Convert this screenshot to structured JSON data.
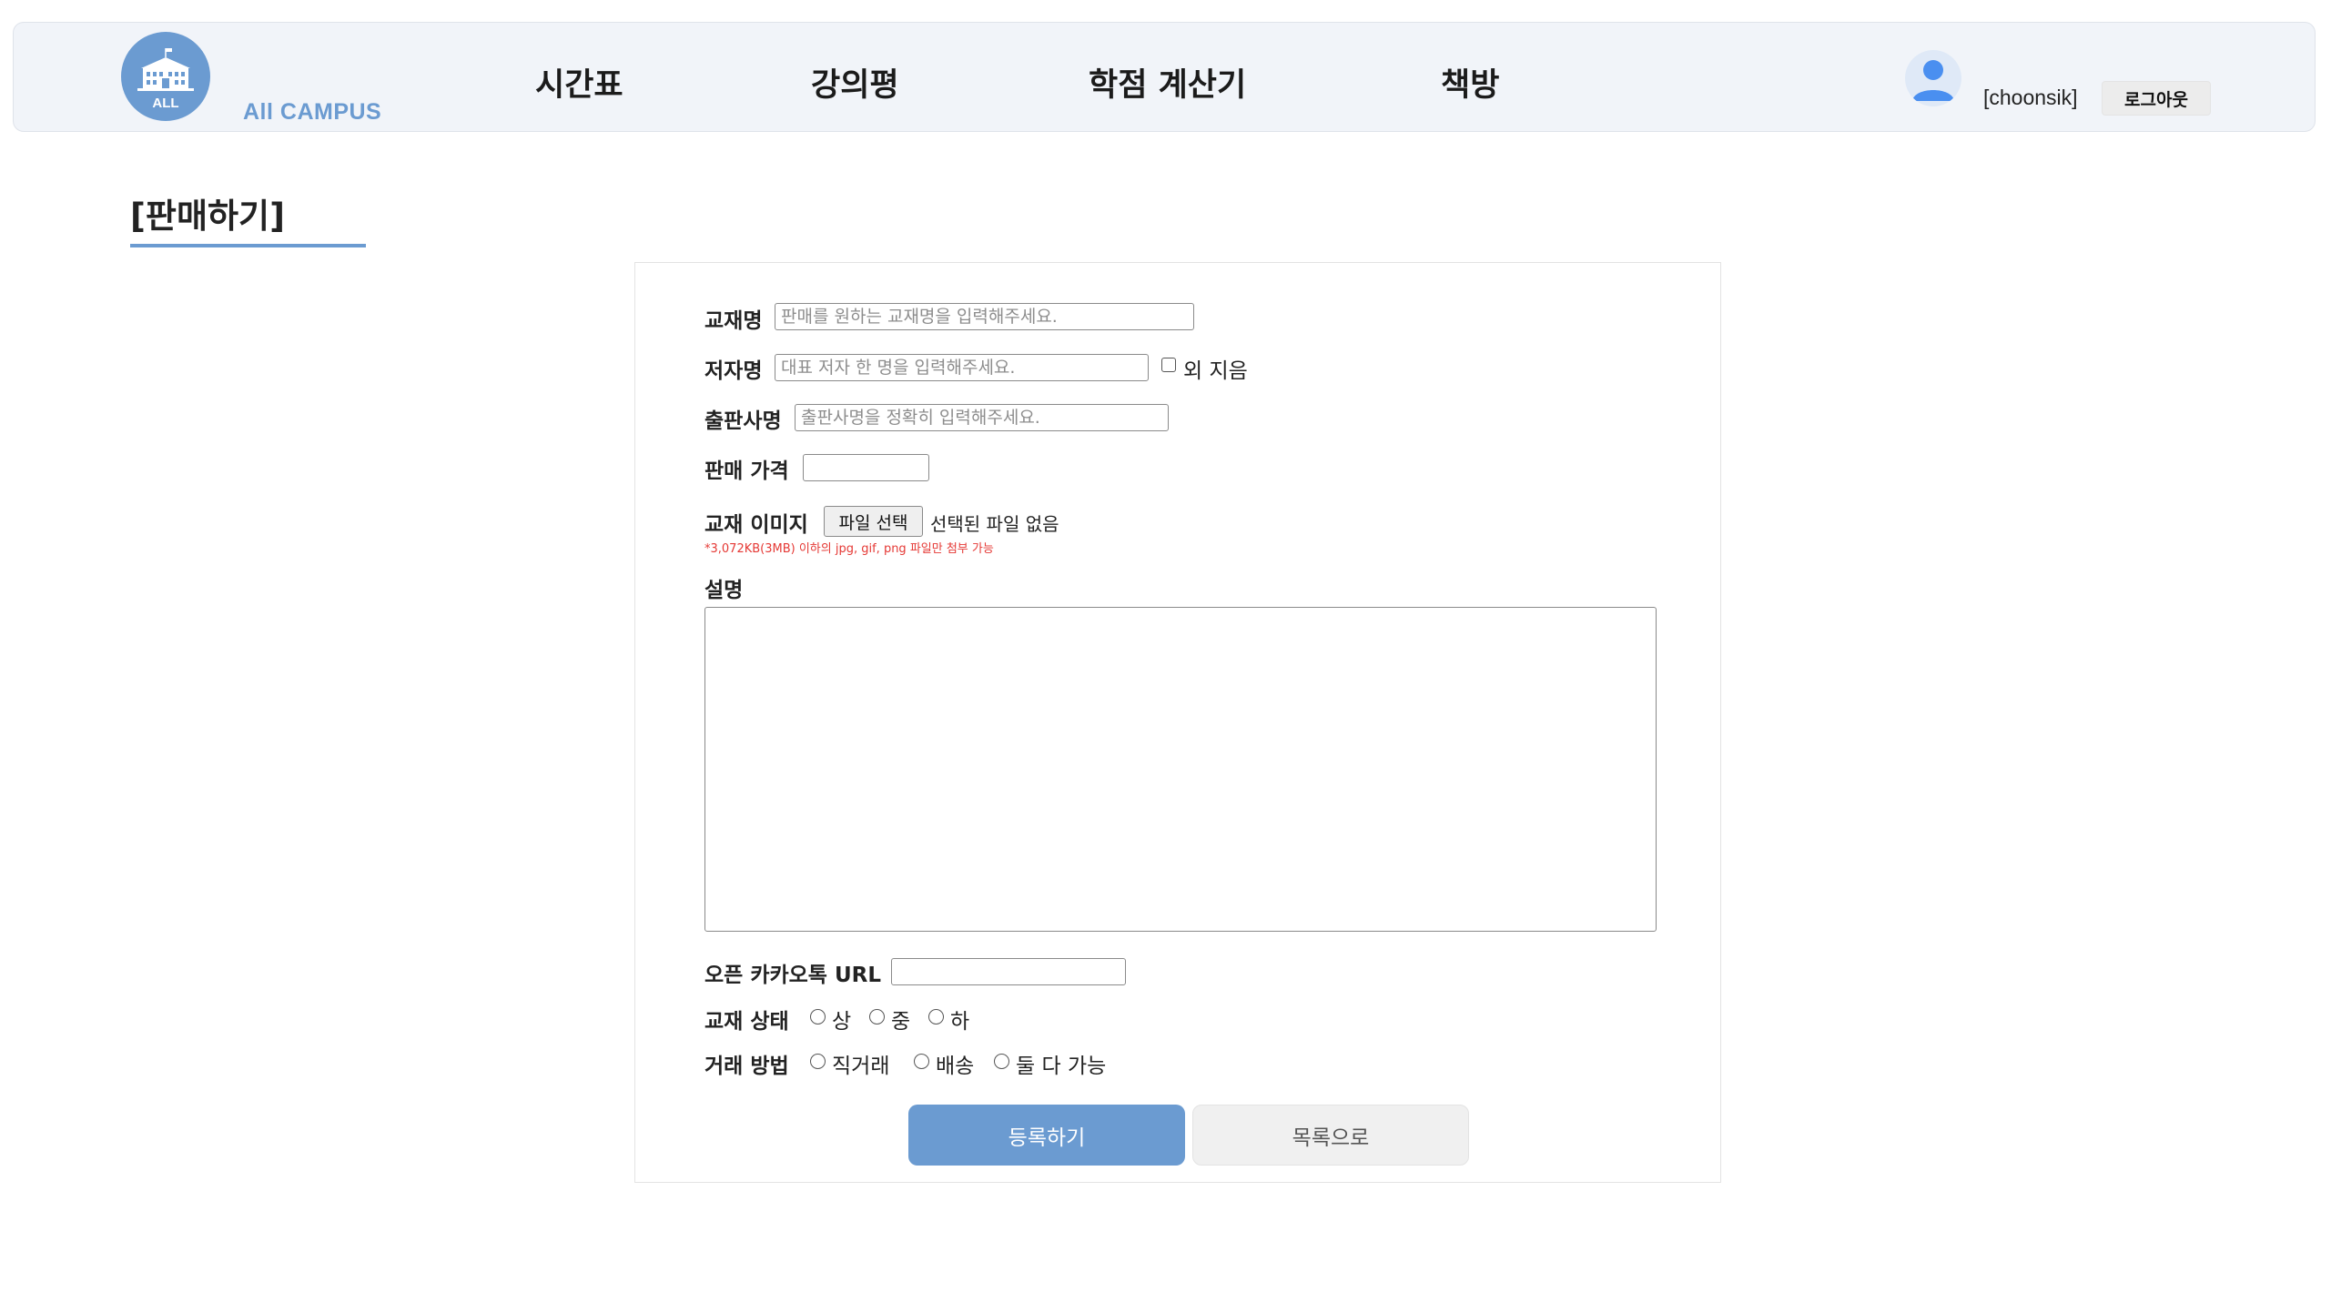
{
  "header": {
    "brand": "All CAMPUS",
    "logo_text": "ALL",
    "nav": [
      {
        "label": "시간표"
      },
      {
        "label": "강의평"
      },
      {
        "label": "학점 계산기"
      },
      {
        "label": "책방"
      }
    ],
    "username": "[choonsik]",
    "logout_label": "로그아웃",
    "accent_color": "#6b9bd1"
  },
  "page": {
    "title": "[판매하기]"
  },
  "form": {
    "book_name": {
      "label": "교재명",
      "placeholder": "판매를 원하는 교재명을 입력해주세요.",
      "value": ""
    },
    "author": {
      "label": "저자명",
      "placeholder": "대표 저자 한 명을 입력해주세요.",
      "value": "",
      "others_label": "외 지음",
      "others_checked": false
    },
    "publisher": {
      "label": "출판사명",
      "placeholder": "출판사명을 정확히 입력해주세요.",
      "value": ""
    },
    "price": {
      "label": "판매 가격",
      "value": ""
    },
    "image": {
      "label": "교재 이미지",
      "button_label": "파일 선택",
      "status": "선택된 파일 없음",
      "note": "*3,072KB(3MB) 이하의 jpg, gif, png 파일만 첨부 가능"
    },
    "description": {
      "label": "설명",
      "value": ""
    },
    "kakao": {
      "label": "오픈 카카오톡 URL",
      "value": ""
    },
    "condition": {
      "label": "교재 상태",
      "options": [
        "상",
        "중",
        "하"
      ]
    },
    "trade": {
      "label": "거래 방법",
      "options": [
        "직거래",
        "배송",
        "둘 다 가능"
      ]
    },
    "submit_label": "등록하기",
    "list_label": "목록으로"
  }
}
